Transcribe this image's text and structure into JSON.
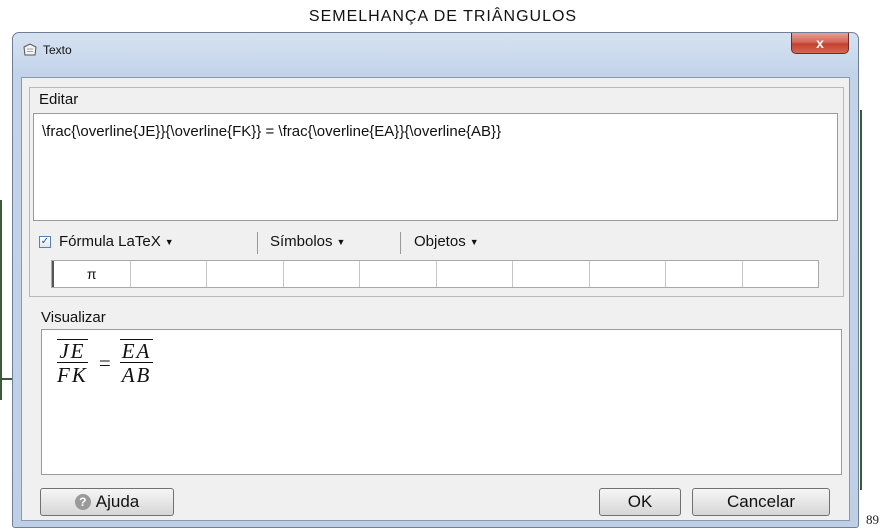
{
  "page": {
    "title": "SEMELHANÇA DE TRIÂNGULOS",
    "page_number": "89"
  },
  "dialog": {
    "title": "Texto",
    "close_label": "x",
    "editor": {
      "legend": "Editar",
      "value": "\\frac{\\overline{JE}}{\\overline{FK}} = \\frac{\\overline{EA}}{\\overline{AB}}"
    },
    "toolbar": {
      "latex_checked": true,
      "latex_label": "Fórmula LaTeX",
      "symbols_label": "Símbolos",
      "objects_label": "Objetos"
    },
    "symbol_cells": [
      "π",
      "",
      "",
      "",
      "",
      "",
      "",
      "",
      "",
      ""
    ],
    "preview": {
      "legend": "Visualizar",
      "left_numerator": "JE",
      "left_denominator": "FK",
      "equals": "=",
      "right_numerator": "EA",
      "right_denominator": "AB"
    },
    "buttons": {
      "help": "Ajuda",
      "ok": "OK",
      "cancel": "Cancelar"
    }
  },
  "colors": {
    "title_bar": "#c3d4ea",
    "close_button": "#c3402f",
    "dialog_background": "#f0f0f0"
  }
}
